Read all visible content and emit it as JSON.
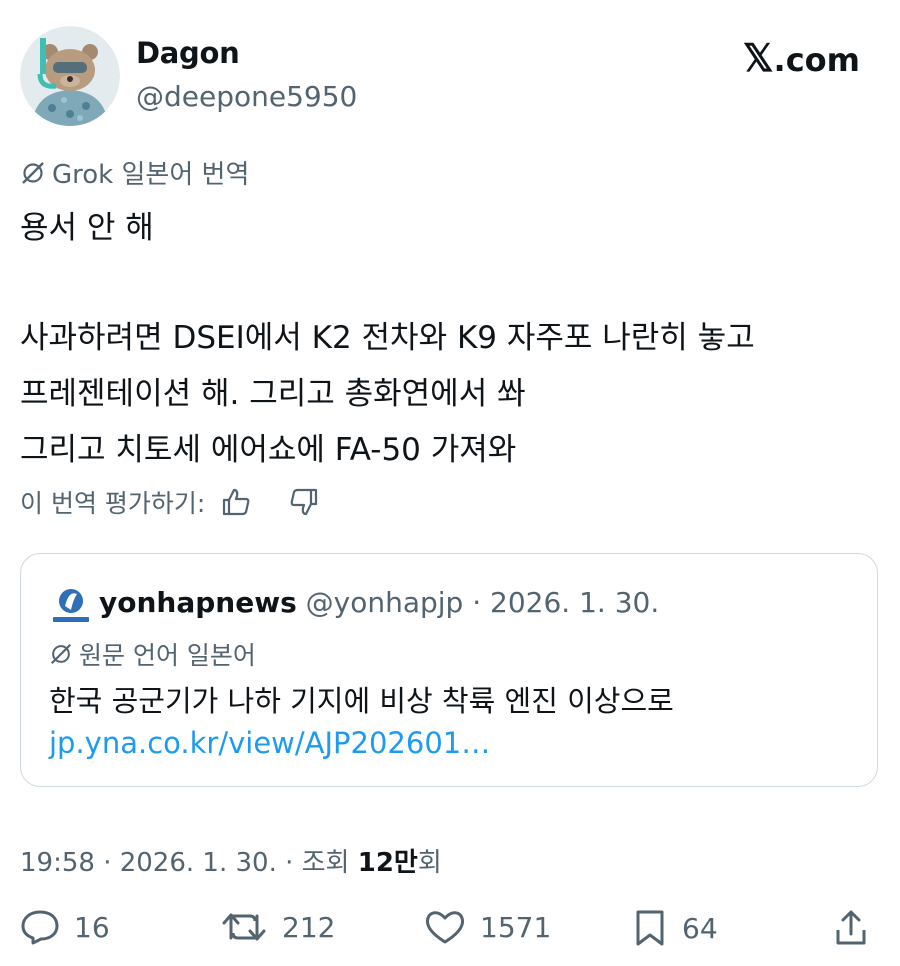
{
  "author": {
    "name": "Dagon",
    "handle": "@deepone5950"
  },
  "site_label": "com",
  "translation": {
    "label": "Grok 일본어 번역",
    "lines": [
      "용서 안 해",
      "사과하려면 DSEI에서 K2 전차와 K9 자주포 나란히 놓고",
      "프레젠테이션 해. 그리고 총화연에서 쏴",
      "그리고 치토세 에어쇼에 FA-50 가져와"
    ],
    "rate_label": "이 번역 평가하기:"
  },
  "quote": {
    "name": "yonhapnews",
    "meta": "@yonhapjp · 2026. 1. 30.",
    "lang_label": "원문 언어 일본어",
    "text": "한국 공군기가 나하 기지에 비상 착륙 엔진 이상으로",
    "link": "jp.yna.co.kr/view/AJP202601…"
  },
  "meta": {
    "time_date": "19:58 · 2026. 1. 30. · 조회 ",
    "views_number": "12만",
    "views_suffix": "회"
  },
  "actions": {
    "replies": "16",
    "retweets": "212",
    "likes": "1571",
    "bookmarks": "64"
  },
  "colors": {
    "text": "#0f1419",
    "muted": "#536471",
    "link": "#1d9bf0",
    "border": "#cfd9de"
  }
}
